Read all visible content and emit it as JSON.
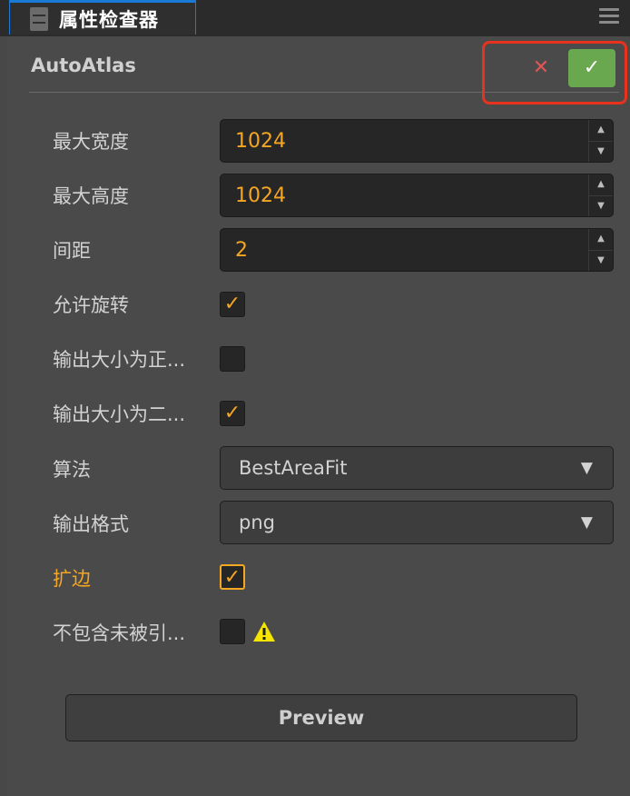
{
  "tab": {
    "title": "属性检查器",
    "icon": "inspector-icon"
  },
  "header": {
    "title": "AutoAtlas",
    "revert_icon": "close-icon",
    "apply_icon": "check-icon"
  },
  "properties": {
    "max_width": {
      "label": "最大宽度",
      "value": "1024"
    },
    "max_height": {
      "label": "最大高度",
      "value": "1024"
    },
    "padding": {
      "label": "间距",
      "value": "2"
    },
    "allow_rotation": {
      "label": "允许旋转",
      "checked": true
    },
    "force_squared": {
      "label": "输出大小为正...",
      "checked": false
    },
    "power_of_two": {
      "label": "输出大小为二...",
      "checked": true
    },
    "algorithm": {
      "label": "算法",
      "value": "BestAreaFit"
    },
    "format": {
      "label": "输出格式",
      "value": "png"
    },
    "extrude": {
      "label": "扩边",
      "checked": true
    },
    "filter_unused": {
      "label": "不包含未被引...",
      "checked": false
    }
  },
  "preview": {
    "label": "Preview"
  },
  "colors": {
    "accent": "#f5a623",
    "apply_green": "#6aa84f",
    "highlight": "#e8321e",
    "tab_blue": "#1a7bd6"
  }
}
